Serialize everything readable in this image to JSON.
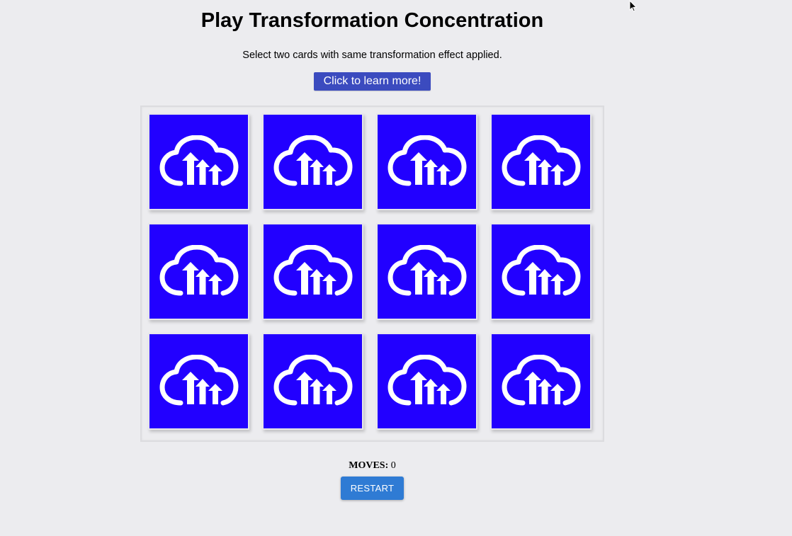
{
  "header": {
    "title": "Play Transformation Concentration",
    "subtitle": "Select two cards with same transformation effect applied.",
    "learn_more_label": "Click to learn more!"
  },
  "board": {
    "rows": 3,
    "columns": 4,
    "card_back_icon": "cloud-upload-icon",
    "card_back_color": "#2200ff",
    "cards": [
      {
        "state": "face-down"
      },
      {
        "state": "face-down"
      },
      {
        "state": "face-down"
      },
      {
        "state": "face-down"
      },
      {
        "state": "face-down"
      },
      {
        "state": "face-down"
      },
      {
        "state": "face-down"
      },
      {
        "state": "face-down"
      },
      {
        "state": "face-down"
      },
      {
        "state": "face-down"
      },
      {
        "state": "face-down"
      },
      {
        "state": "face-down"
      }
    ]
  },
  "footer": {
    "moves_label": "MOVES:",
    "moves_value": "0",
    "restart_label": "RESTART"
  },
  "colors": {
    "background": "#ececef",
    "learn_button": "#3b4bbf",
    "restart_button": "#2f7bd4"
  }
}
